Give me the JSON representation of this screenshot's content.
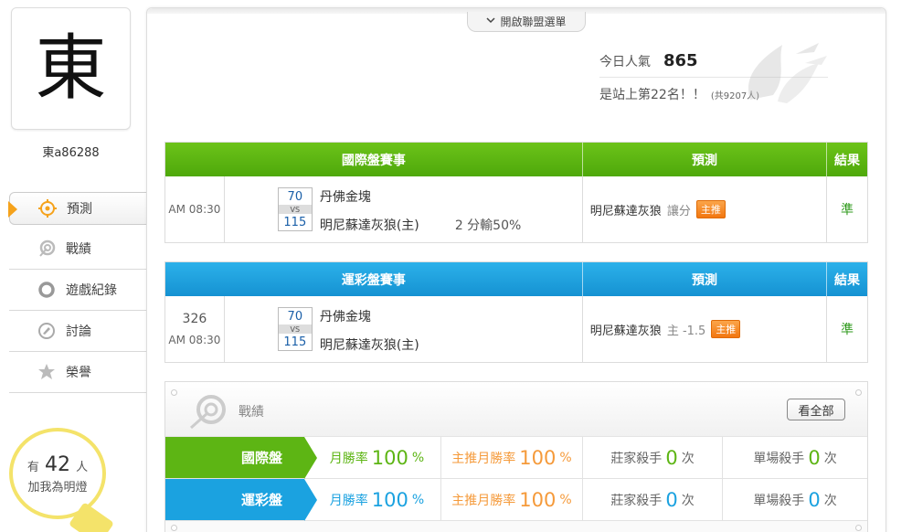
{
  "profile": {
    "avatar_char": "東",
    "username": "東a86288"
  },
  "nav": {
    "items": [
      {
        "label": "預測",
        "icon": "target-icon",
        "active": true
      },
      {
        "label": "戰績",
        "icon": "record-icon"
      },
      {
        "label": "遊戲紀錄",
        "icon": "ring-icon"
      },
      {
        "label": "討論",
        "icon": "discussion-icon"
      },
      {
        "label": "榮譽",
        "icon": "medal-icon"
      }
    ]
  },
  "fans": {
    "prefix": "有",
    "count": "42",
    "suffix": "人",
    "line2": "加我為明燈"
  },
  "league_menu": {
    "label": "開啟聯盟選單"
  },
  "popularity": {
    "label": "今日人氣",
    "value": "865",
    "rank_text": "是站上第22名！！",
    "total_text": "(共9207人)"
  },
  "intl_match": {
    "header": {
      "game": "國際盤賽事",
      "prediction": "預測",
      "result": "結果"
    },
    "number": "",
    "time": "AM 08:30",
    "score1": "70",
    "vs": "VS",
    "score2": "115",
    "team1": "丹佛金塊",
    "team2": "明尼蘇達灰狼(主)",
    "odds": "2 分輸50%",
    "pred_team": "明尼蘇達灰狼",
    "pred_type": "讓分",
    "badge": "主推",
    "result": "準"
  },
  "lottery_match": {
    "header": {
      "game": "運彩盤賽事",
      "prediction": "預測",
      "result": "結果"
    },
    "number": "326",
    "time": "AM 08:30",
    "score1": "70",
    "vs": "VS",
    "score2": "115",
    "team1": "丹佛金塊",
    "team2": "明尼蘇達灰狼(主)",
    "pred_team": "明尼蘇達灰狼",
    "pred_type": "主 -1.5",
    "badge": "主推",
    "result": "準"
  },
  "record": {
    "title": "戰績",
    "view_all": "看全部",
    "rows": [
      {
        "name": "國際盤",
        "monthly_label": "月勝率",
        "monthly_value": "100",
        "monthly_unit": "%",
        "main_label": "主推月勝率",
        "main_value": "100",
        "main_unit": "%",
        "house_label": "莊家殺手",
        "house_value": "0",
        "house_unit": "次",
        "single_label": "單場殺手",
        "single_value": "0",
        "single_unit": "次"
      },
      {
        "name": "運彩盤",
        "monthly_label": "月勝率",
        "monthly_value": "100",
        "monthly_unit": "%",
        "main_label": "主推月勝率",
        "main_value": "100",
        "main_unit": "%",
        "house_label": "莊家殺手",
        "house_value": "0",
        "house_unit": "次",
        "single_label": "單場殺手",
        "single_value": "0",
        "single_unit": "次"
      }
    ]
  },
  "colors": {
    "green": "#5db514",
    "blue": "#1ba2e0",
    "orange": "#f59a3a"
  }
}
